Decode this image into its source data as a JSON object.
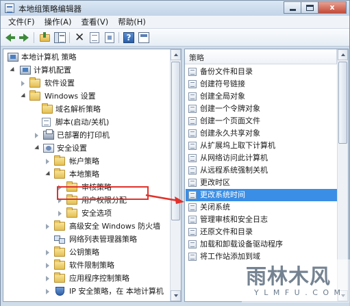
{
  "window": {
    "title": "本地组策略编辑器",
    "buttons": {
      "minimize": "",
      "maximize": "",
      "close": "x"
    }
  },
  "menubar": {
    "items": [
      "文件(F)",
      "操作(A)",
      "查看(V)",
      "帮助(H)"
    ]
  },
  "toolbar": {
    "icons": [
      "back-icon",
      "forward-icon",
      "up-folder-icon",
      "show-hide-tree-icon",
      "delete-icon",
      "properties-icon",
      "export-list-icon",
      "help-icon",
      "snapin-icon"
    ]
  },
  "tree": {
    "items": [
      {
        "label": "本地计算机 策略",
        "icon": "computer-policy-icon",
        "level": 0,
        "expand": "none"
      },
      {
        "label": "计算机配置",
        "icon": "computer-icon",
        "level": 1,
        "expand": "expanded"
      },
      {
        "label": "软件设置",
        "icon": "folder-icon",
        "level": 2,
        "expand": "collapsed"
      },
      {
        "label": "Windows 设置",
        "icon": "folder-icon",
        "level": 2,
        "expand": "expanded"
      },
      {
        "label": "域名解析策略",
        "icon": "folder-icon",
        "level": 3,
        "expand": "none"
      },
      {
        "label": "脚本(启动/关机)",
        "icon": "document-icon",
        "level": 3,
        "expand": "none"
      },
      {
        "label": "已部署的打印机",
        "icon": "printer-icon",
        "level": 3,
        "expand": "collapsed"
      },
      {
        "label": "安全设置",
        "icon": "gear-icon",
        "level": 3,
        "expand": "expanded"
      },
      {
        "label": "帐户策略",
        "icon": "folder-icon",
        "level": 4,
        "expand": "collapsed"
      },
      {
        "label": "本地策略",
        "icon": "folder-icon",
        "level": 4,
        "expand": "expanded"
      },
      {
        "label": "审核策略",
        "icon": "folder-icon",
        "level": 5,
        "expand": "collapsed"
      },
      {
        "label": "用户权限分配",
        "icon": "folder-icon",
        "level": 5,
        "expand": "collapsed"
      },
      {
        "label": "安全选项",
        "icon": "folder-icon",
        "level": 5,
        "expand": "collapsed"
      },
      {
        "label": "高级安全 Windows 防火墙",
        "icon": "folder-icon",
        "level": 4,
        "expand": "collapsed"
      },
      {
        "label": "网络列表管理器策略",
        "icon": "network-icon",
        "level": 4,
        "expand": "none"
      },
      {
        "label": "公钥策略",
        "icon": "folder-icon",
        "level": 4,
        "expand": "collapsed"
      },
      {
        "label": "软件限制策略",
        "icon": "folder-icon",
        "level": 4,
        "expand": "collapsed"
      },
      {
        "label": "应用程序控制策略",
        "icon": "folder-icon",
        "level": 4,
        "expand": "collapsed"
      },
      {
        "label": "IP 安全策略，在 本地计算机",
        "icon": "shield-icon",
        "level": 4,
        "expand": "collapsed"
      }
    ],
    "highlighted": "用户权限分配"
  },
  "list": {
    "header": "策略",
    "items": [
      "备份文件和目录",
      "创建符号链接",
      "创建全局对象",
      "创建一个令牌对象",
      "创建一个页面文件",
      "创建永久共享对象",
      "从扩展坞上取下计算机",
      "从网络访问此计算机",
      "从远程系统强制关机",
      "更改时区",
      "更改系统时间",
      "关闭系统",
      "管理审核和安全日志",
      "还原文件和目录",
      "加载和卸载设备驱动程序",
      "将工作站添加到域"
    ],
    "selected": "更改系统时间"
  },
  "watermark": {
    "main": "雨林木风",
    "sub": "Y L M F U . C O M"
  },
  "colors": {
    "selection": "#3a8ee6",
    "highlight_box": "#e0312a",
    "window_frame": "#cfdcea"
  }
}
